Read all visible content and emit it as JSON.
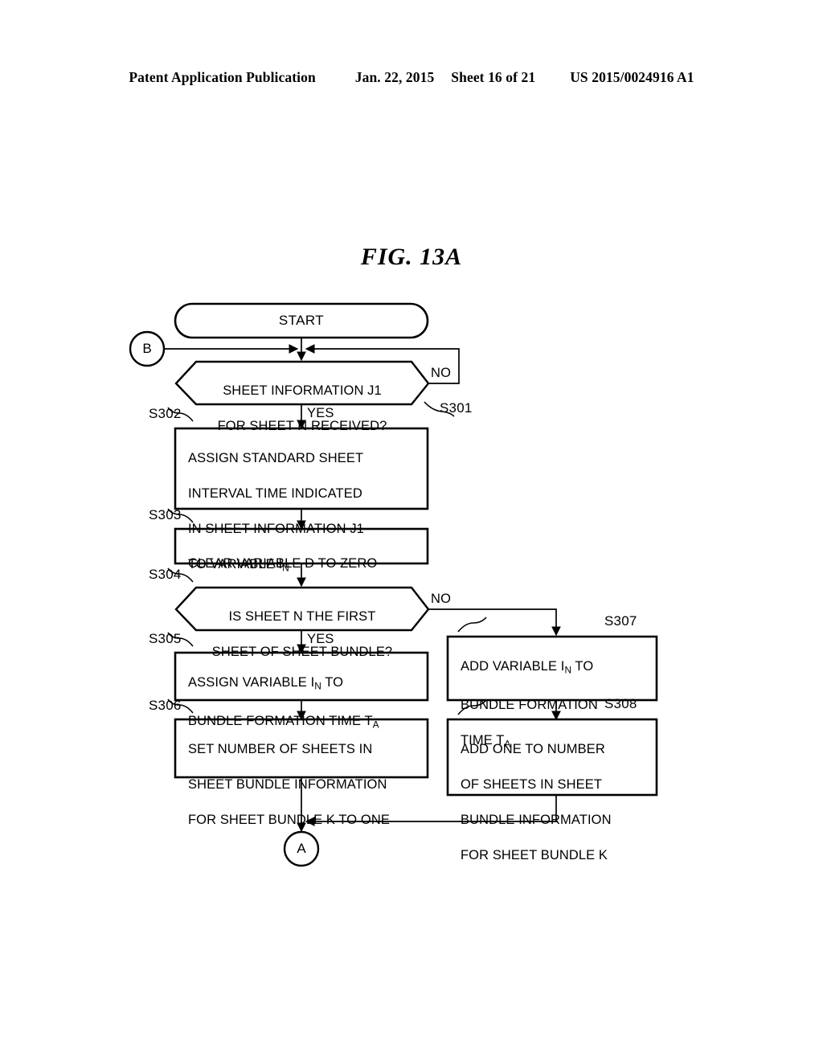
{
  "header": {
    "publication": "Patent Application Publication",
    "date": "Jan. 22, 2015",
    "sheet": "Sheet 16 of 21",
    "number": "US 2015/0024916 A1"
  },
  "figure": {
    "title": "FIG. 13A",
    "type": "flowchart"
  },
  "flowchart": {
    "terminals": [
      {
        "id": "start",
        "label": "START",
        "shape": "stadium"
      }
    ],
    "connectors": [
      {
        "id": "conn-b",
        "label": "B",
        "shape": "circle",
        "role": "entry"
      },
      {
        "id": "conn-a",
        "label": "A",
        "shape": "circle",
        "role": "exit"
      }
    ],
    "decisions": [
      {
        "id": "s301",
        "step": "S301",
        "shape": "hexagon",
        "line1": "SHEET INFORMATION J1",
        "line2": "FOR SHEET N RECEIVED?",
        "yes_label": "YES",
        "no_label": "NO"
      },
      {
        "id": "s304",
        "step": "S304",
        "shape": "hexagon",
        "line1": "IS SHEET N THE FIRST",
        "line2": "SHEET OF SHEET BUNDLE?",
        "yes_label": "YES",
        "no_label": "NO"
      }
    ],
    "processes": [
      {
        "id": "s302",
        "step": "S302",
        "shape": "rect",
        "align": "left",
        "line1": "ASSIGN STANDARD SHEET",
        "line2": "INTERVAL TIME INDICATED",
        "line3": "IN SHEET INFORMATION J1",
        "line4_pre": "TO VARIABLE I",
        "line4_sub": "N",
        "line4_post": ""
      },
      {
        "id": "s303",
        "step": "S303",
        "shape": "rect",
        "align": "left",
        "line1": "CLEAR VARIABLE D TO ZERO"
      },
      {
        "id": "s305",
        "step": "S305",
        "shape": "rect",
        "align": "left",
        "line1_pre": "ASSIGN VARIABLE I",
        "line1_sub": "N",
        "line1_post": " TO",
        "line2_pre": "BUNDLE FORMATION TIME T",
        "line2_sub": "A",
        "line2_post": ""
      },
      {
        "id": "s306",
        "step": "S306",
        "shape": "rect",
        "align": "left",
        "line1": "SET NUMBER OF SHEETS IN",
        "line2": "SHEET BUNDLE INFORMATION",
        "line3": "FOR SHEET BUNDLE K TO ONE"
      },
      {
        "id": "s307",
        "step": "S307",
        "shape": "rect",
        "align": "left",
        "line1_pre": "ADD VARIABLE I",
        "line1_sub": "N",
        "line1_post": " TO",
        "line2": "BUNDLE FORMATION",
        "line3_pre": "TIME T",
        "line3_sub": "A",
        "line3_post": ""
      },
      {
        "id": "s308",
        "step": "S308",
        "shape": "rect",
        "align": "left",
        "line1": "ADD ONE TO NUMBER",
        "line2": "OF SHEETS IN SHEET",
        "line3": "BUNDLE INFORMATION",
        "line4": "FOR SHEET BUNDLE K"
      }
    ],
    "colors": {
      "stroke": "#000000",
      "fill": "#ffffff",
      "text": "#000000"
    }
  }
}
